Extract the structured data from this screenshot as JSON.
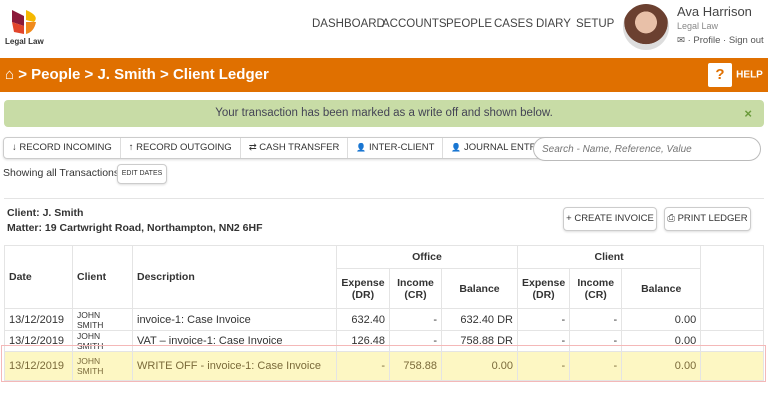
{
  "brand": {
    "name": "Legal Law"
  },
  "nav": [
    "DASHBOARD",
    "ACCOUNTS",
    "PEOPLE",
    "CASES",
    "DIARY",
    "SETUP"
  ],
  "user": {
    "name": "Ava Harrison",
    "firm": "Legal Law",
    "profile": "Profile",
    "signout": "Sign out",
    "sep": "·"
  },
  "breadcrumb": {
    "items": [
      "People",
      "J. Smith",
      "Client Ledger"
    ],
    "sep": ">"
  },
  "help": {
    "label": "HELP",
    "icon": "?"
  },
  "alert": {
    "message": "Your transaction has been marked as a write off and shown below.",
    "close": "×"
  },
  "toolbar": [
    "RECORD INCOMING",
    "RECORD OUTGOING",
    "CASH TRANSFER",
    "INTER-CLIENT",
    "JOURNAL ENTRY"
  ],
  "toolbar_icons": [
    "↓",
    "↑",
    "⇄",
    "👤",
    "👤"
  ],
  "search": {
    "placeholder": "Search - Name, Reference, Value"
  },
  "filter": {
    "text": "Showing all Transactions",
    "edit": "EDIT DATES"
  },
  "ledger": {
    "client": "Client: J. Smith",
    "matter": "Matter: 19 Cartwright Road, Northampton, NN2 6HF",
    "create": "CREATE INVOICE",
    "print": "PRINT LEDGER"
  },
  "table": {
    "headers": {
      "date": "Date",
      "client": "Client",
      "description": "Description",
      "office": "Office",
      "client_group": "Client",
      "expense": "Expense (DR)",
      "income": "Income (CR)",
      "balance": "Balance"
    },
    "rows": [
      [
        "13/12/2019",
        "JOHN SMITH",
        "invoice-1: Case Invoice",
        "632.40",
        "-",
        "632.40 DR",
        "-",
        "-",
        "0.00"
      ],
      [
        "13/12/2019",
        "JOHN SMITH",
        "VAT – invoice-1: Case Invoice",
        "126.48",
        "-",
        "758.88 DR",
        "-",
        "-",
        "0.00"
      ],
      [
        "13/12/2019",
        "JOHN SMITH",
        "WRITE OFF - invoice-1: Case Invoice",
        "-",
        "758.88",
        "0.00",
        "-",
        "-",
        "0.00"
      ]
    ]
  },
  "colors": {
    "accent": "#e07000",
    "alert": "#c8dca6",
    "highlight": "#fdf7c3"
  }
}
